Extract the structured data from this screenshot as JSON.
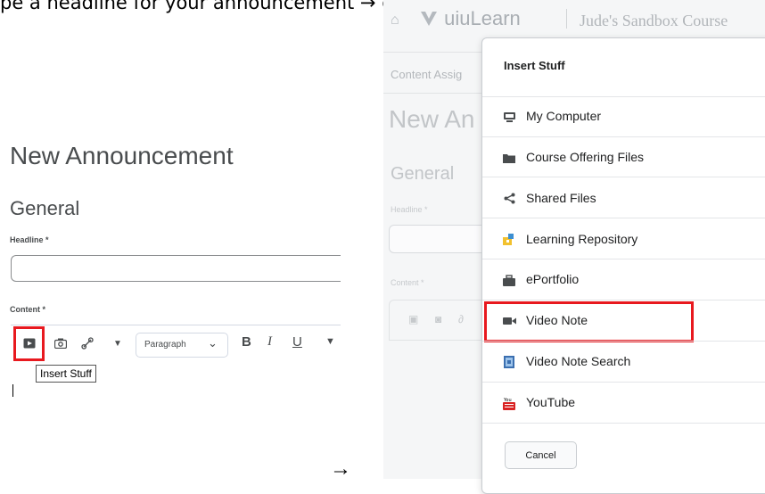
{
  "caption": "pe a headline for your announcement → click the Insert Stuff     icon → se",
  "left_panel": {
    "title": "New Announcement",
    "section": "General",
    "headline_label": "Headline *",
    "content_label": "Content *",
    "paragraph_select": "Paragraph",
    "bold": "B",
    "italic": "I",
    "underline": "U",
    "tooltip": "Insert Stuff"
  },
  "arrow": "→",
  "right_panel": {
    "background": {
      "course": "Jude's Sandbox Course",
      "logo": "uiuLearn",
      "nav": "Content  Assig",
      "title": "New An",
      "section": "General",
      "headline_label": "Headline *",
      "content_label": "Content *"
    },
    "dialog": {
      "title": "Insert Stuff",
      "items": [
        {
          "label": "My Computer",
          "icon": "computer-icon"
        },
        {
          "label": "Course Offering Files",
          "icon": "folder-icon"
        },
        {
          "label": "Shared Files",
          "icon": "share-icon"
        },
        {
          "label": "Learning Repository",
          "icon": "repository-icon"
        },
        {
          "label": "ePortfolio",
          "icon": "eportfolio-icon"
        },
        {
          "label": "Video Note",
          "icon": "video-camera-icon"
        },
        {
          "label": "Video Note Search",
          "icon": "video-search-icon"
        },
        {
          "label": "YouTube",
          "icon": "youtube-icon"
        }
      ],
      "cancel_label": "Cancel"
    }
  },
  "colors": {
    "highlight": "#e8191f",
    "text": "#202122",
    "muted": "#494c4e"
  }
}
